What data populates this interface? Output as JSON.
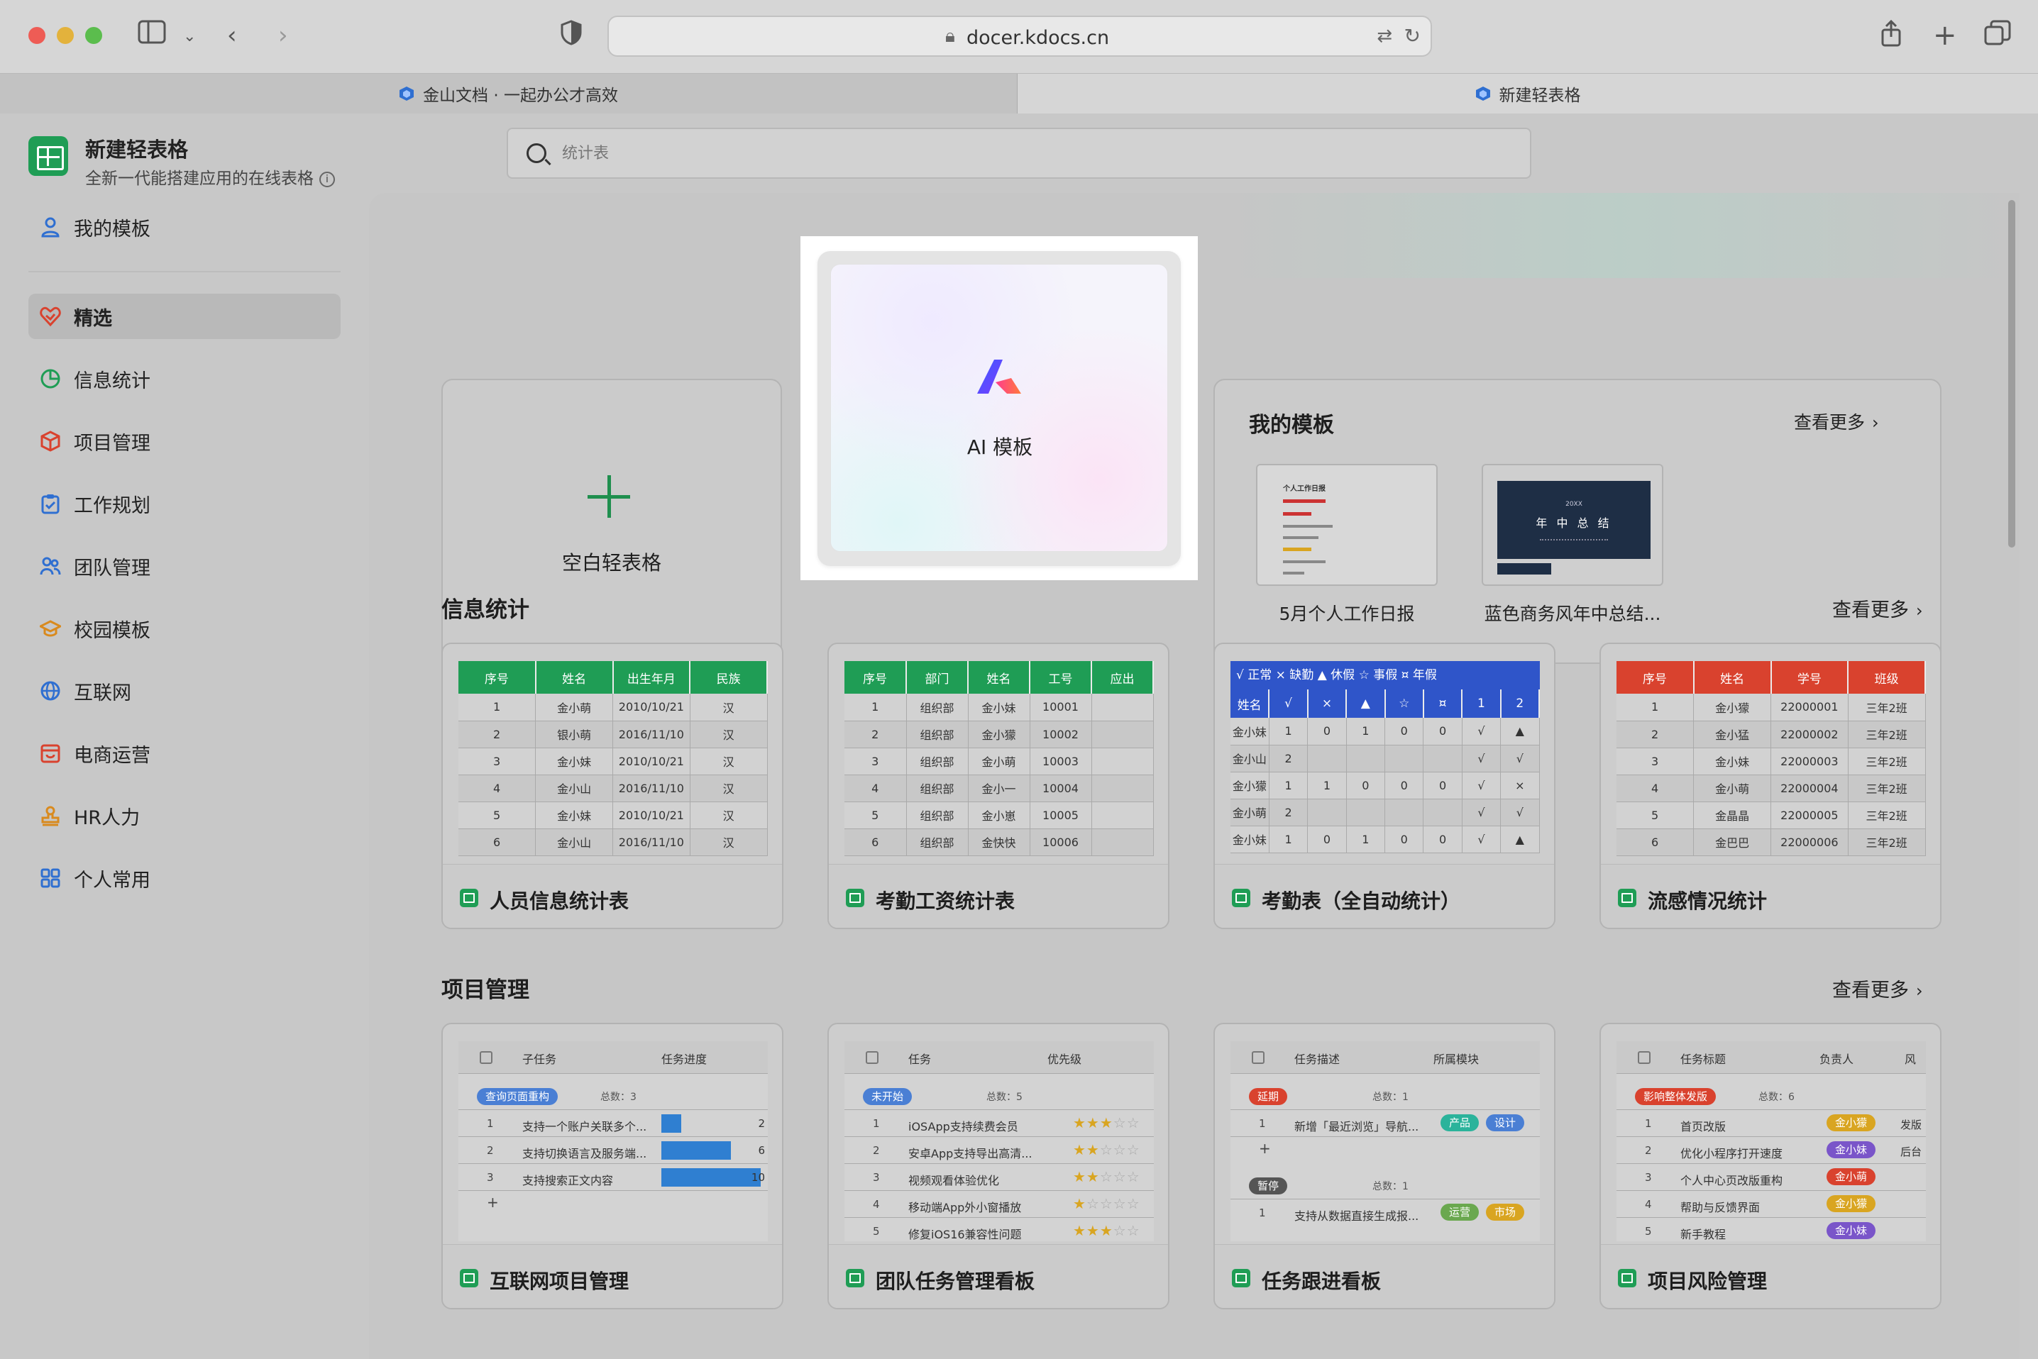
{
  "browser": {
    "url": "docer.kdocs.cn",
    "tabs": [
      {
        "label": "金山文档 · 一起办公才高效"
      },
      {
        "label": "新建轻表格"
      }
    ]
  },
  "app": {
    "title": "新建轻表格",
    "subtitle": "全新一代能搭建应用的在线表格",
    "search_placeholder": "统计表"
  },
  "sidebar": {
    "my_templates": "我的模板",
    "items": [
      {
        "label": "精选",
        "icon": "heart-badge-icon",
        "color": "#d9422e",
        "active": true
      },
      {
        "label": "信息统计",
        "icon": "pie-chart-icon",
        "color": "#1f9d55"
      },
      {
        "label": "项目管理",
        "icon": "cube-icon",
        "color": "#d9422e"
      },
      {
        "label": "工作规划",
        "icon": "clipboard-icon",
        "color": "#2f6fd1"
      },
      {
        "label": "团队管理",
        "icon": "team-icon",
        "color": "#2f6fd1"
      },
      {
        "label": "校园模板",
        "icon": "graduation-cap-icon",
        "color": "#d98a1e"
      },
      {
        "label": "互联网",
        "icon": "globe-icon",
        "color": "#2f6fd1"
      },
      {
        "label": "电商运营",
        "icon": "store-icon",
        "color": "#d9422e"
      },
      {
        "label": "HR人力",
        "icon": "stamp-icon",
        "color": "#d98a1e"
      },
      {
        "label": "个人常用",
        "icon": "apps-grid-icon",
        "color": "#2f6fd1"
      }
    ]
  },
  "top_cards": {
    "blank_label": "空白轻表格",
    "ai_label": "AI 模板",
    "my_templates_title": "我的模板",
    "see_more": "查看更多",
    "my_templates": [
      {
        "name": "5月个人工作日报"
      },
      {
        "name": "蓝色商务风年中总结..."
      }
    ],
    "thumb2_text_small": "20XX",
    "thumb2_text_big": "年 中 总 结",
    "thumb1_title": "个人工作日报"
  },
  "sections": [
    {
      "title": "信息统计",
      "see_more": "查看更多",
      "cards": [
        {
          "name": "人员信息统计表",
          "color": "#1f9d55",
          "headers": [
            "序号",
            "姓名",
            "出生年月",
            "民族"
          ],
          "rows": [
            [
              "1",
              "金小萌",
              "2010/10/21",
              "汉"
            ],
            [
              "2",
              "银小萌",
              "2016/11/10",
              "汉"
            ],
            [
              "3",
              "金小妹",
              "2010/10/21",
              "汉"
            ],
            [
              "4",
              "金小山",
              "2016/11/10",
              "汉"
            ],
            [
              "5",
              "金小妹",
              "2010/10/21",
              "汉"
            ],
            [
              "6",
              "金小山",
              "2016/11/10",
              "汉"
            ]
          ]
        },
        {
          "name": "考勤工资统计表",
          "color": "#1f9d55",
          "headers": [
            "序号",
            "部门",
            "姓名",
            "工号",
            "应出"
          ],
          "rows": [
            [
              "1",
              "组织部",
              "金小妹",
              "10001",
              ""
            ],
            [
              "2",
              "组织部",
              "金小獴",
              "10002",
              ""
            ],
            [
              "3",
              "组织部",
              "金小萌",
              "10003",
              ""
            ],
            [
              "4",
              "组织部",
              "金小一",
              "10004",
              ""
            ],
            [
              "5",
              "组织部",
              "金小崽",
              "10005",
              ""
            ],
            [
              "6",
              "组织部",
              "金快快",
              "10006",
              ""
            ]
          ]
        },
        {
          "name": "考勤表（全自动统计）",
          "color": "#2f55c9",
          "legend": "√ 正常 × 缺勤 ▲ 休假 ☆ 事假 ¤ 年假",
          "headers": [
            "姓名",
            "√",
            "×",
            "▲",
            "☆",
            "¤",
            "1",
            "2"
          ],
          "rows": [
            [
              "金小妹",
              "1",
              "0",
              "1",
              "0",
              "0",
              "√",
              "▲"
            ],
            [
              "金小山",
              "2",
              "",
              "",
              "",
              "",
              "√",
              "√"
            ],
            [
              "金小獴",
              "1",
              "1",
              "0",
              "0",
              "0",
              "√",
              "×"
            ],
            [
              "金小萌",
              "2",
              "",
              "",
              "",
              "",
              "√",
              "√"
            ],
            [
              "金小妹",
              "1",
              "0",
              "1",
              "0",
              "0",
              "√",
              "▲"
            ]
          ]
        },
        {
          "name": "流感情况统计",
          "color": "#d9422e",
          "headers": [
            "序号",
            "姓名",
            "学号",
            "班级"
          ],
          "rows": [
            [
              "1",
              "金小獴",
              "22000001",
              "三年2班"
            ],
            [
              "2",
              "金小猛",
              "22000002",
              "三年2班"
            ],
            [
              "3",
              "金小妹",
              "22000003",
              "三年2班"
            ],
            [
              "4",
              "金小萌",
              "22000004",
              "三年2班"
            ],
            [
              "5",
              "金晶晶",
              "22000005",
              "三年2班"
            ],
            [
              "6",
              "金巴巴",
              "22000006",
              "三年2班"
            ]
          ]
        }
      ]
    },
    {
      "title": "项目管理",
      "see_more": "查看更多",
      "cards": [
        {
          "name": "互联网项目管理",
          "col1": "子任务",
          "col2": "任务进度",
          "group": "查询页面重构",
          "group_color": "#4a7fd4",
          "total": "总数：3",
          "rows": [
            {
              "n": "1",
              "t": "支持一个账户关联多个...",
              "v": "2",
              "p": 0.2
            },
            {
              "n": "2",
              "t": "支持切换语言及服务端...",
              "v": "6",
              "p": 0.7
            },
            {
              "n": "3",
              "t": "支持搜索正文内容",
              "v": "10",
              "p": 1.0
            }
          ]
        },
        {
          "name": "团队任务管理看板",
          "col1": "任务",
          "col2": "优先级",
          "group": "未开始",
          "group_color": "#4a7fd4",
          "total": "总数：5",
          "rows": [
            {
              "n": "1",
              "t": "iOSApp支持续费会员",
              "s": 3
            },
            {
              "n": "2",
              "t": "安卓App支持导出高清...",
              "s": 2
            },
            {
              "n": "3",
              "t": "视频观看体验优化",
              "s": 2
            },
            {
              "n": "4",
              "t": "移动端App外小窗播放",
              "s": 1
            },
            {
              "n": "5",
              "t": "修复iOS16兼容性问题",
              "s": 3
            }
          ]
        },
        {
          "name": "任务跟进看板",
          "col1": "任务描述",
          "col2": "所属模块",
          "groups": [
            {
              "label": "延期",
              "color": "#d9422e",
              "total": "总数：1",
              "rows": [
                {
                  "n": "1",
                  "t": "新增「最近浏览」导航...",
                  "tags": [
                    {
                      "t": "产品",
                      "c": "#2bb39b"
                    },
                    {
                      "t": "设计",
                      "c": "#4a7fd4"
                    }
                  ]
                }
              ]
            },
            {
              "label": "暂停",
              "color": "#555555",
              "total": "总数：1",
              "rows": [
                {
                  "n": "1",
                  "t": "支持从数据直接生成报...",
                  "tags": [
                    {
                      "t": "运营",
                      "c": "#6aa84f"
                    },
                    {
                      "t": "市场",
                      "c": "#d9a521"
                    }
                  ]
                }
              ]
            }
          ]
        },
        {
          "name": "项目风险管理",
          "col1": "任务标题",
          "col2": "负责人",
          "col3": "风",
          "group": "影响整体发版",
          "group_color": "#d9422e",
          "total": "总数：6",
          "rows": [
            {
              "n": "1",
              "t": "首页改版",
              "o": "金小獴",
              "oc": "#d9a521",
              "x": "发版"
            },
            {
              "n": "2",
              "t": "优化小程序打开速度",
              "o": "金小妹",
              "oc": "#7a55c9",
              "x": "后台"
            },
            {
              "n": "3",
              "t": "个人中心页改版重构",
              "o": "金小萌",
              "oc": "#d9422e",
              "x": ""
            },
            {
              "n": "4",
              "t": "帮助与反馈界面",
              "o": "金小獴",
              "oc": "#d9a521",
              "x": ""
            },
            {
              "n": "5",
              "t": "新手教程",
              "o": "金小妹",
              "oc": "#7a55c9",
              "x": ""
            }
          ]
        }
      ]
    }
  ]
}
